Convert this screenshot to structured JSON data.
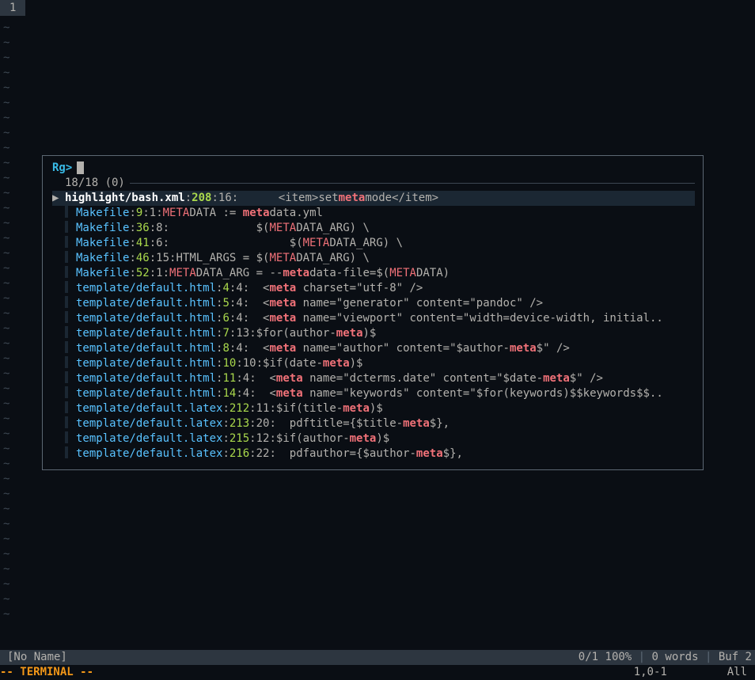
{
  "tab": {
    "label": "1"
  },
  "tildes": 40,
  "fzf": {
    "prompt": "Rg>",
    "count": "18/18 (0)",
    "rows": [
      {
        "selected": true,
        "marker": "▶",
        "path": "highlight/bash.xml",
        "line": "208",
        "col": "16",
        "segments": [
          {
            "t": "      <item>set",
            "c": "content"
          },
          {
            "t": "meta",
            "c": "match"
          },
          {
            "t": "mode</item>",
            "c": "content"
          }
        ]
      },
      {
        "path": "Makefile",
        "line": "9",
        "col": "1",
        "segments": [
          {
            "t": "META",
            "c": "match-up"
          },
          {
            "t": "DATA := ",
            "c": "content"
          },
          {
            "t": "meta",
            "c": "match"
          },
          {
            "t": "data.yml",
            "c": "content"
          }
        ]
      },
      {
        "path": "Makefile",
        "line": "36",
        "col": "8",
        "segments": [
          {
            "t": "             $(",
            "c": "content"
          },
          {
            "t": "META",
            "c": "match-up"
          },
          {
            "t": "DATA_ARG) \\",
            "c": "content"
          }
        ]
      },
      {
        "path": "Makefile",
        "line": "41",
        "col": "6",
        "segments": [
          {
            "t": "                  $(",
            "c": "content"
          },
          {
            "t": "META",
            "c": "match-up"
          },
          {
            "t": "DATA_ARG) \\",
            "c": "content"
          }
        ]
      },
      {
        "path": "Makefile",
        "line": "46",
        "col": "15",
        "segments": [
          {
            "t": "HTML_ARGS = $(",
            "c": "content"
          },
          {
            "t": "META",
            "c": "match-up"
          },
          {
            "t": "DATA_ARG) \\",
            "c": "content"
          }
        ]
      },
      {
        "path": "Makefile",
        "line": "52",
        "col": "1",
        "segments": [
          {
            "t": "META",
            "c": "match-up"
          },
          {
            "t": "DATA_ARG = --",
            "c": "content"
          },
          {
            "t": "meta",
            "c": "match"
          },
          {
            "t": "data-file=$(",
            "c": "content"
          },
          {
            "t": "META",
            "c": "match-up"
          },
          {
            "t": "DATA)",
            "c": "content"
          }
        ]
      },
      {
        "path": "template/default.html",
        "line": "4",
        "col": "4",
        "segments": [
          {
            "t": "  <",
            "c": "content"
          },
          {
            "t": "meta",
            "c": "match"
          },
          {
            "t": " charset=\"utf-8\" />",
            "c": "content"
          }
        ]
      },
      {
        "path": "template/default.html",
        "line": "5",
        "col": "4",
        "segments": [
          {
            "t": "  <",
            "c": "content"
          },
          {
            "t": "meta",
            "c": "match"
          },
          {
            "t": " name=\"generator\" content=\"pandoc\" />",
            "c": "content"
          }
        ]
      },
      {
        "path": "template/default.html",
        "line": "6",
        "col": "4",
        "segments": [
          {
            "t": "  <",
            "c": "content"
          },
          {
            "t": "meta",
            "c": "match"
          },
          {
            "t": " name=\"viewport\" content=\"width=device-width, initial..",
            "c": "content"
          }
        ]
      },
      {
        "path": "template/default.html",
        "line": "7",
        "col": "13",
        "segments": [
          {
            "t": "$for(author-",
            "c": "content"
          },
          {
            "t": "meta",
            "c": "match"
          },
          {
            "t": ")$",
            "c": "content"
          }
        ]
      },
      {
        "path": "template/default.html",
        "line": "8",
        "col": "4",
        "segments": [
          {
            "t": "  <",
            "c": "content"
          },
          {
            "t": "meta",
            "c": "match"
          },
          {
            "t": " name=\"author\" content=\"$author-",
            "c": "content"
          },
          {
            "t": "meta",
            "c": "match"
          },
          {
            "t": "$\" />",
            "c": "content"
          }
        ]
      },
      {
        "path": "template/default.html",
        "line": "10",
        "col": "10",
        "segments": [
          {
            "t": "$if(date-",
            "c": "content"
          },
          {
            "t": "meta",
            "c": "match"
          },
          {
            "t": ")$",
            "c": "content"
          }
        ]
      },
      {
        "path": "template/default.html",
        "line": "11",
        "col": "4",
        "segments": [
          {
            "t": "  <",
            "c": "content"
          },
          {
            "t": "meta",
            "c": "match"
          },
          {
            "t": " name=\"dcterms.date\" content=\"$date-",
            "c": "content"
          },
          {
            "t": "meta",
            "c": "match"
          },
          {
            "t": "$\" />",
            "c": "content"
          }
        ]
      },
      {
        "path": "template/default.html",
        "line": "14",
        "col": "4",
        "segments": [
          {
            "t": "  <",
            "c": "content"
          },
          {
            "t": "meta",
            "c": "match"
          },
          {
            "t": " name=\"keywords\" content=\"$for(keywords)$$keywords$$..",
            "c": "content"
          }
        ]
      },
      {
        "path": "template/default.latex",
        "line": "212",
        "col": "11",
        "segments": [
          {
            "t": "$if(title-",
            "c": "content"
          },
          {
            "t": "meta",
            "c": "match"
          },
          {
            "t": ")$",
            "c": "content"
          }
        ]
      },
      {
        "path": "template/default.latex",
        "line": "213",
        "col": "20",
        "segments": [
          {
            "t": "  pdftitle={$title-",
            "c": "content"
          },
          {
            "t": "meta",
            "c": "match"
          },
          {
            "t": "$},",
            "c": "content"
          }
        ]
      },
      {
        "path": "template/default.latex",
        "line": "215",
        "col": "12",
        "segments": [
          {
            "t": "$if(author-",
            "c": "content"
          },
          {
            "t": "meta",
            "c": "match"
          },
          {
            "t": ")$",
            "c": "content"
          }
        ]
      },
      {
        "path": "template/default.latex",
        "line": "216",
        "col": "22",
        "segments": [
          {
            "t": "  pdfauthor={$author-",
            "c": "content"
          },
          {
            "t": "meta",
            "c": "match"
          },
          {
            "t": "$},",
            "c": "content"
          }
        ]
      }
    ]
  },
  "status": {
    "left": "[No Name]",
    "right_parts": [
      "0/1 100%",
      " | ",
      "0 words",
      " | ",
      "Buf 2"
    ]
  },
  "cmdline": {
    "mode": "-- TERMINAL --",
    "ruler_pos": "1,0-1",
    "ruler_pct": "All"
  }
}
